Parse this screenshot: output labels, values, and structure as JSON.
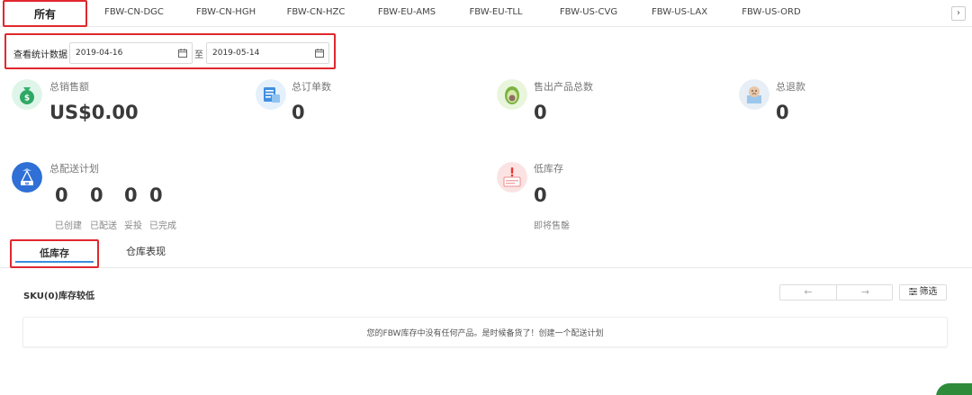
{
  "warehouse_tabs": [
    "所有",
    "FBW-CN-DGC",
    "FBW-CN-HGH",
    "FBW-CN-HZC",
    "FBW-EU-AMS",
    "FBW-EU-TLL",
    "FBW-US-CVG",
    "FBW-US-LAX",
    "FBW-US-ORD"
  ],
  "next_arrow": "›",
  "date_filter": {
    "label": "查看统计数据",
    "start": "2019-04-16",
    "separator": "至",
    "end": "2019-05-14"
  },
  "stats": {
    "total_sales": {
      "label": "总销售额",
      "value": "US$0.00",
      "icon": "money-bag-icon"
    },
    "total_orders": {
      "label": "总订单数",
      "value": "0",
      "icon": "order-list-icon"
    },
    "total_products_sold": {
      "label": "售出产品总数",
      "value": "0",
      "icon": "avocado-icon"
    },
    "total_refunds": {
      "label": "总退款",
      "value": "0",
      "icon": "refund-box-icon"
    }
  },
  "shipping_plans": {
    "label": "总配送计划",
    "icon": "delivery-icon",
    "values": [
      "0",
      "0",
      "0",
      "0"
    ],
    "sub_labels": [
      "已创建",
      "已配送",
      "妥投",
      "已完成"
    ]
  },
  "low_stock": {
    "label": "低库存",
    "value": "0",
    "sub_label": "即将售罄",
    "icon": "low-stock-alert-icon"
  },
  "lower_tabs": [
    "低库存",
    "仓库表现"
  ],
  "sku_title": "SKU(0)库存较低",
  "pager": {
    "prev": "←",
    "next": "→"
  },
  "filter_button": "筛选",
  "empty_message": "您的FBW库存中没有任何产品。是时候备货了！创建一个配送计划",
  "colors": {
    "highlight_red": "#e0282e",
    "accent_blue": "#3a8dde",
    "help_green": "#2e8b3a"
  }
}
